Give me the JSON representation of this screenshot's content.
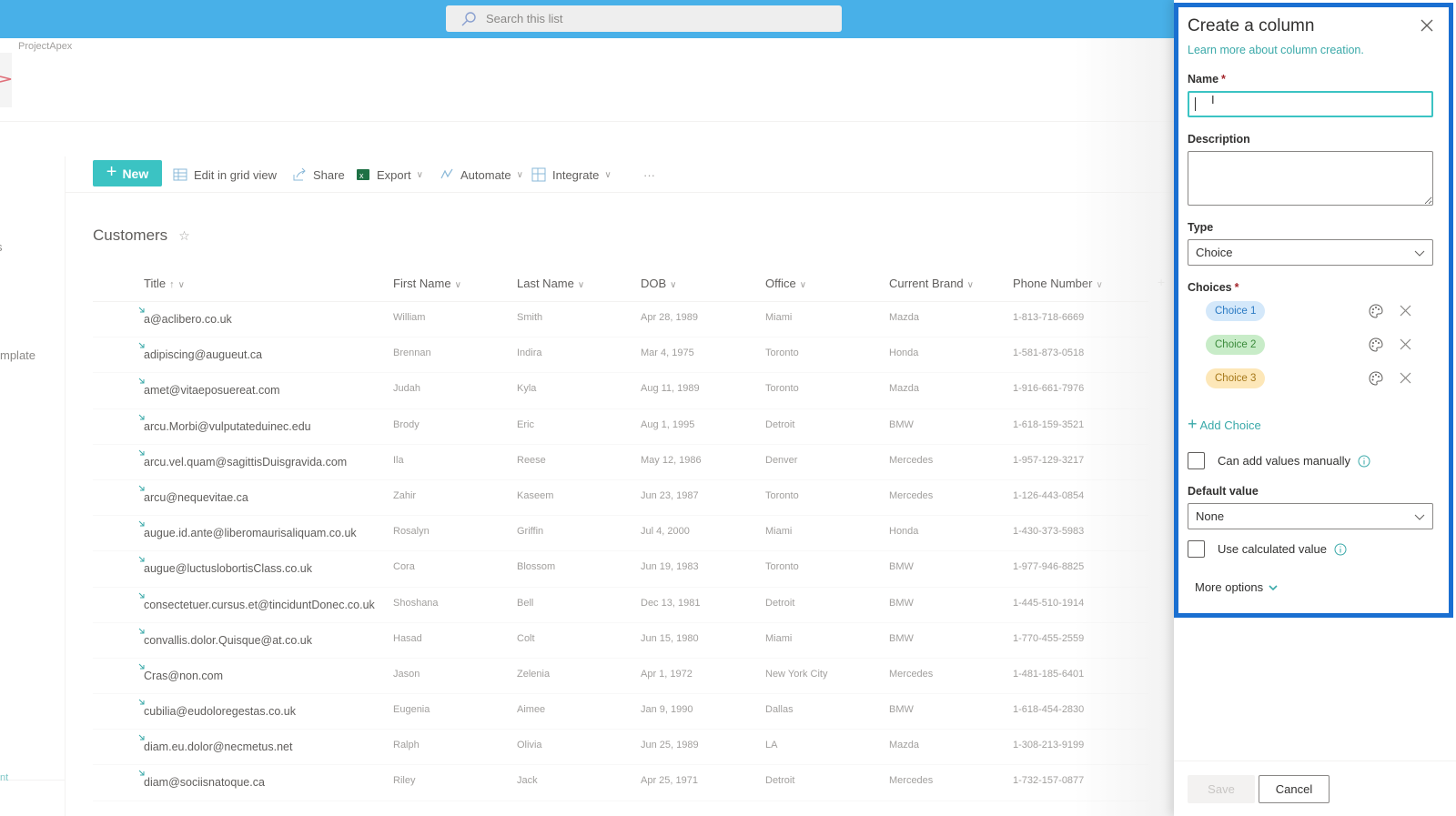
{
  "search": {
    "placeholder": "Search this list",
    "icon": "search-icon"
  },
  "site": {
    "name": "ProjectApex"
  },
  "leftnav": {
    "items": [
      "s",
      "mplate",
      "nt"
    ]
  },
  "commandbar": {
    "new_label": "New",
    "edit_grid_label": "Edit in grid view",
    "share_label": "Share",
    "export_label": "Export",
    "automate_label": "Automate",
    "integrate_label": "Integrate",
    "more_label": "···"
  },
  "list": {
    "title": "Customers",
    "columns": [
      {
        "label": "Title",
        "sort": "↑"
      },
      {
        "label": "First Name"
      },
      {
        "label": "Last Name"
      },
      {
        "label": "DOB"
      },
      {
        "label": "Office"
      },
      {
        "label": "Current Brand"
      },
      {
        "label": "Phone Number"
      }
    ],
    "add_column": "+",
    "rows": [
      [
        "a@aclibero.co.uk",
        "William",
        "Smith",
        "Apr 28, 1989",
        "Miami",
        "Mazda",
        "1-813-718-6669"
      ],
      [
        "adipiscing@augueut.ca",
        "Brennan",
        "Indira",
        "Mar 4, 1975",
        "Toronto",
        "Honda",
        "1-581-873-0518"
      ],
      [
        "amet@vitaeposuereat.com",
        "Judah",
        "Kyla",
        "Aug 11, 1989",
        "Toronto",
        "Mazda",
        "1-916-661-7976"
      ],
      [
        "arcu.Morbi@vulputateduinec.edu",
        "Brody",
        "Eric",
        "Aug 1, 1995",
        "Detroit",
        "BMW",
        "1-618-159-3521"
      ],
      [
        "arcu.vel.quam@sagittisDuisgravida.com",
        "Ila",
        "Reese",
        "May 12, 1986",
        "Denver",
        "Mercedes",
        "1-957-129-3217"
      ],
      [
        "arcu@nequevitae.ca",
        "Zahir",
        "Kaseem",
        "Jun 23, 1987",
        "Toronto",
        "Mercedes",
        "1-126-443-0854"
      ],
      [
        "augue.id.ante@liberomaurisaliquam.co.uk",
        "Rosalyn",
        "Griffin",
        "Jul 4, 2000",
        "Miami",
        "Honda",
        "1-430-373-5983"
      ],
      [
        "augue@luctuslobortisClass.co.uk",
        "Cora",
        "Blossom",
        "Jun 19, 1983",
        "Toronto",
        "BMW",
        "1-977-946-8825"
      ],
      [
        "consectetuer.cursus.et@tinciduntDonec.co.uk",
        "Shoshana",
        "Bell",
        "Dec 13, 1981",
        "Detroit",
        "BMW",
        "1-445-510-1914"
      ],
      [
        "convallis.dolor.Quisque@at.co.uk",
        "Hasad",
        "Colt",
        "Jun 15, 1980",
        "Miami",
        "BMW",
        "1-770-455-2559"
      ],
      [
        "Cras@non.com",
        "Jason",
        "Zelenia",
        "Apr 1, 1972",
        "New York City",
        "Mercedes",
        "1-481-185-6401"
      ],
      [
        "cubilia@eudoloregestas.co.uk",
        "Eugenia",
        "Aimee",
        "Jan 9, 1990",
        "Dallas",
        "BMW",
        "1-618-454-2830"
      ],
      [
        "diam.eu.dolor@necmetus.net",
        "Ralph",
        "Olivia",
        "Jun 25, 1989",
        "LA",
        "Mazda",
        "1-308-213-9199"
      ],
      [
        "diam@sociisnatoque.ca",
        "Riley",
        "Jack",
        "Apr 25, 1971",
        "Detroit",
        "Mercedes",
        "1-732-157-0877"
      ]
    ]
  },
  "panel": {
    "title": "Create a column",
    "learn_more": "Learn more about column creation.",
    "name_label": "Name",
    "name_value": "",
    "required_mark": "*",
    "description_label": "Description",
    "description_value": "",
    "type_label": "Type",
    "type_value": "Choice",
    "choices_label": "Choices",
    "choices": [
      {
        "label": "Choice 1",
        "bg": "#d4e8fa",
        "fg": "#2b7bc4"
      },
      {
        "label": "Choice 2",
        "bg": "#c8ecc8",
        "fg": "#3a8a3a"
      },
      {
        "label": "Choice 3",
        "bg": "#fde7b8",
        "fg": "#a6781a"
      }
    ],
    "add_choice_label": "Add Choice",
    "can_add_manually_label": "Can add values manually",
    "can_add_manually_checked": false,
    "default_value_label": "Default value",
    "default_value": "None",
    "use_calculated_label": "Use calculated value",
    "use_calculated_checked": false,
    "more_options_label": "More options",
    "save_label": "Save",
    "cancel_label": "Cancel"
  },
  "colors": {
    "topbar": "#48b0e8",
    "accent": "#3bc3c3",
    "link": "#3aa9a9",
    "highlight_border": "#1a6fd1"
  }
}
